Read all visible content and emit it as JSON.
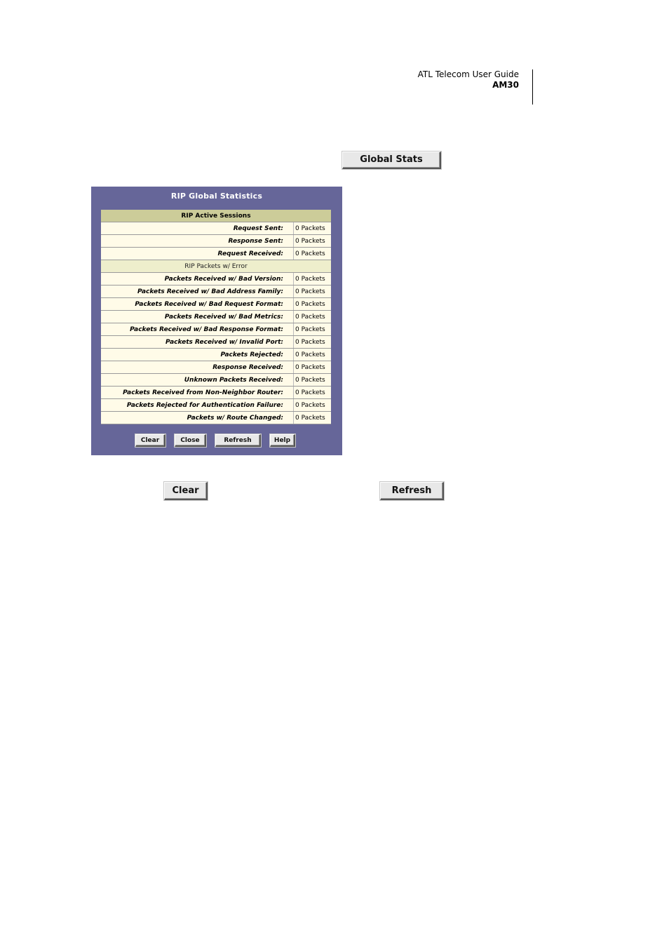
{
  "header": {
    "title": "ATL Telecom User Guide",
    "model": "AM30"
  },
  "global_stats_button": "Global Stats",
  "panel": {
    "title": "RIP Global Statistics",
    "sections": [
      {
        "heading": "RIP Active Sessions",
        "rows": [
          {
            "label": "Request Sent:",
            "value": "0 Packets"
          },
          {
            "label": "Response Sent:",
            "value": "0 Packets"
          },
          {
            "label": "Request Received:",
            "value": "0 Packets"
          }
        ]
      },
      {
        "heading": "RIP Packets w/ Error",
        "rows": [
          {
            "label": "Packets Received w/ Bad Version:",
            "value": "0 Packets"
          },
          {
            "label": "Packets Received w/ Bad Address Family:",
            "value": "0 Packets"
          },
          {
            "label": "Packets Received w/ Bad Request Format:",
            "value": "0 Packets"
          },
          {
            "label": "Packets Received w/ Bad Metrics:",
            "value": "0 Packets"
          },
          {
            "label": "Packets Received w/ Bad Response Format:",
            "value": "0 Packets"
          },
          {
            "label": "Packets Received w/ Invalid Port:",
            "value": "0 Packets"
          },
          {
            "label": "Packets Rejected:",
            "value": "0 Packets"
          },
          {
            "label": "Response Received:",
            "value": "0 Packets"
          },
          {
            "label": "Unknown Packets Received:",
            "value": "0 Packets"
          },
          {
            "label": "Packets Received from Non-Neighbor Router:",
            "value": "0 Packets"
          },
          {
            "label": "Packets Rejected for Authentication Failure:",
            "value": "0 Packets"
          },
          {
            "label": "Packets w/ Route Changed:",
            "value": "0 Packets"
          }
        ]
      }
    ],
    "buttons": {
      "clear": "Clear",
      "close": "Close",
      "refresh": "Refresh",
      "help": "Help"
    }
  },
  "bottom_buttons": {
    "clear": "Clear",
    "refresh": "Refresh"
  },
  "colors": {
    "panel_bg": "#666699",
    "section_header": "#cccc99",
    "row_bg": "#fffbe8"
  }
}
